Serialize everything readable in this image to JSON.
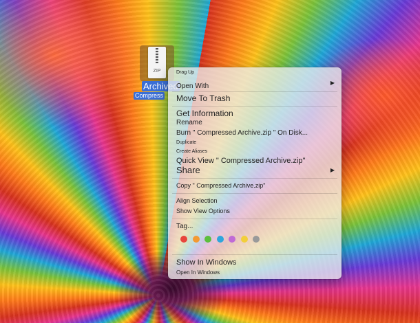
{
  "file": {
    "badge": "ZIP",
    "name_line1": "Archived",
    "name_line2": "Compress"
  },
  "menu": {
    "items": {
      "drag_up": "Drag Up",
      "open_with": "Open With",
      "move_to_trash": "Move To Trash",
      "get_information": "Get Information",
      "rename": "Rename",
      "burn": "Burn \" Compressed Archive.zip \" On Disk...",
      "duplicate": "Duplicate",
      "create_aliases": "Create Aliases",
      "quick_view": "Quick View \" Compressed Archive.zip\"",
      "share": "Share",
      "copy": "Copy \" Compressed Archive.zip\"",
      "align_selection": "Align Selection",
      "show_view_options": "Show View Options",
      "tags": "Tag...",
      "show_in_windows": "Show In Windows",
      "open_in_windows": "Open In Windows"
    },
    "submenu_arrow": "▶",
    "tag_colors": [
      "#e8453c",
      "#f39a33",
      "#5bbf3e",
      "#2fa6dc",
      "#c06ad6",
      "#f2cf3a",
      "#9a9a9a"
    ]
  }
}
